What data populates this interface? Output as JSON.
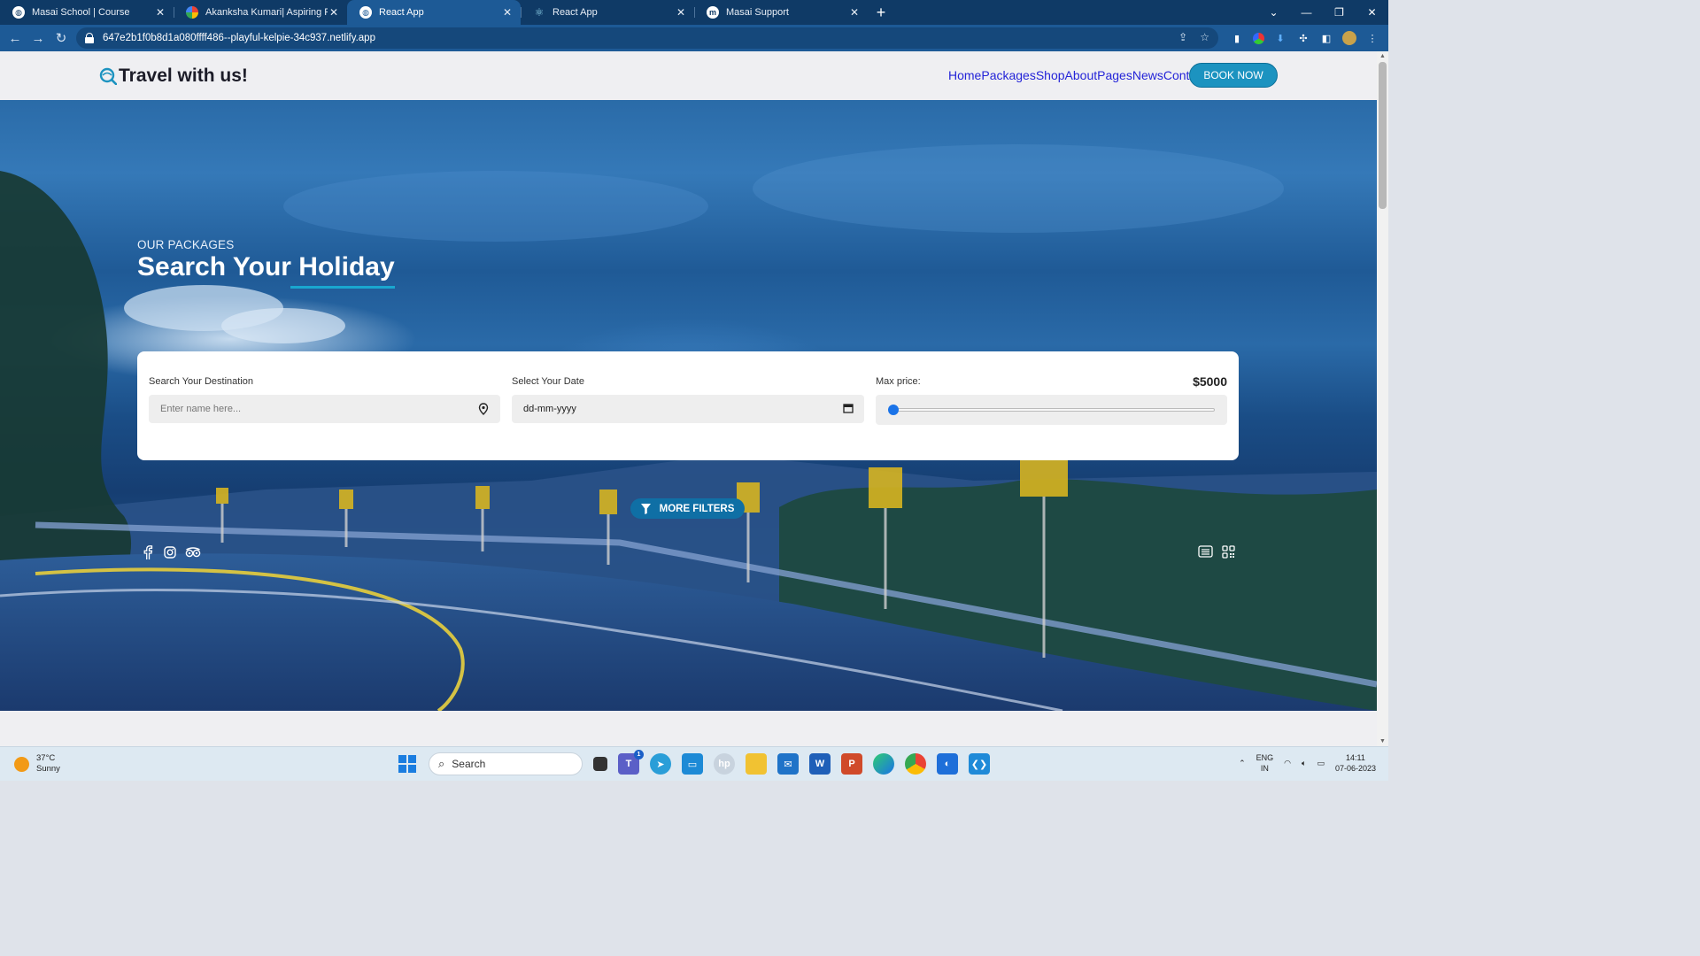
{
  "browser": {
    "tabs": [
      {
        "title": "Masai School | Course",
        "active": false
      },
      {
        "title": "Akanksha Kumari| Aspiring Full S",
        "active": false
      },
      {
        "title": "React App",
        "active": true
      },
      {
        "title": "React App",
        "active": false
      },
      {
        "title": "Masai Support",
        "active": false
      }
    ],
    "url": "647e2b1f0b8d1a080ffff486--playful-kelpie-34c937.netlify.app"
  },
  "site": {
    "logo_text": "Travel with us!",
    "nav": [
      "Home",
      "Packages",
      "Shop",
      "About",
      "Pages",
      "News",
      "Contact"
    ],
    "book_button": "BOOK NOW"
  },
  "hero": {
    "subtitle": "OUR PACKAGES",
    "title": "Search Your Holiday"
  },
  "search": {
    "destination_label": "Search Your Destination",
    "destination_placeholder": "Enter name here...",
    "date_label": "Select Your Date",
    "date_value": "dd-mm-yyyy",
    "price_label": "Max price:",
    "price_value": "$5000",
    "price_slider_fraction": 0,
    "more_filters": "MORE FILTERS"
  },
  "social_icons": [
    "facebook-icon",
    "instagram-icon",
    "tripadvisor-icon"
  ],
  "view_icons": [
    "list-view-icon",
    "grid-view-icon"
  ],
  "colors": {
    "accent": "#1c93c0",
    "nav_link": "#2424d8",
    "filters_button": "#0f6fa5",
    "browser_frame": "#0f3a66"
  },
  "taskbar": {
    "weather_temp": "37°C",
    "weather_desc": "Sunny",
    "search_placeholder": "Search",
    "teams_badge": "1",
    "lang_top": "ENG",
    "lang_bottom": "IN",
    "time": "14:11",
    "date": "07-06-2023"
  }
}
